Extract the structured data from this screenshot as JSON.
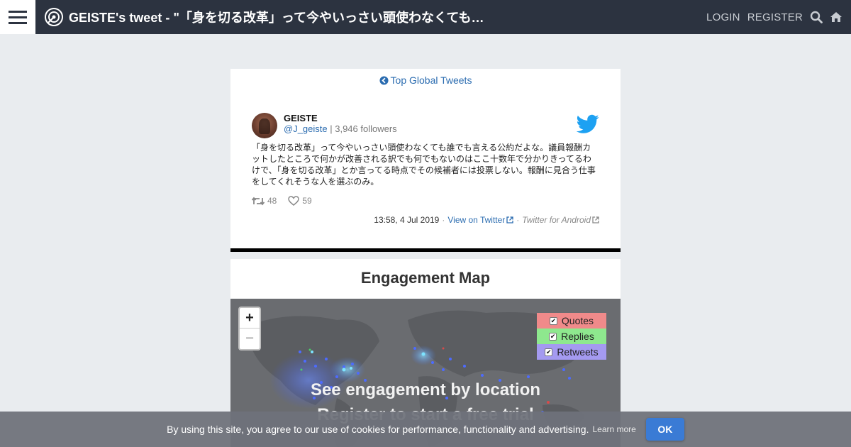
{
  "header": {
    "title": "GEISTE's tweet - \"「身を切る改革」って今やいっさい頭使わなくても…",
    "login_label": "LOGIN",
    "register_label": "REGISTER",
    "icons": [
      "menu-icon",
      "logo-icon",
      "search-icon",
      "home-icon"
    ]
  },
  "tweet": {
    "back_link": "Top Global Tweets",
    "author_name": "GEISTE",
    "handle": "@J_geiste",
    "followers": "| 3,946 followers",
    "text": "「身を切る改革」って今やいっさい頭使わなくても誰でも言える公約だよな。議員報酬カットしたところで何かが改善される訳でも何でもないのはここ十数年で分かりきってるわけで、「身を切る改革」とか言ってる時点でその候補者には投票しない。報酬に見合う仕事をしてくれそうな人を選ぶのみ。",
    "retweets": "48",
    "likes": "59",
    "timestamp": "13:58, 4 Jul 2019",
    "view_link": "View on Twitter",
    "source": "Twitter for Android"
  },
  "engagement": {
    "title": "Engagement Map",
    "zoom_in": "+",
    "zoom_out": "−",
    "legend": [
      {
        "label": "Quotes",
        "color": "#f08a8a",
        "checked": true
      },
      {
        "label": "Replies",
        "color": "#8ee88e",
        "checked": true
      },
      {
        "label": "Retweets",
        "color": "#a49af0",
        "checked": true
      }
    ],
    "overlay_line1": "See engagement by location",
    "overlay_line2": "Register to start a free trial"
  },
  "cookie": {
    "text": "By using this site, you agree to our use of cookies for performance, functionality and advertising.",
    "learn_more": "Learn more",
    "ok_label": "OK"
  },
  "colors": {
    "topbar": "#2c3340",
    "link": "#2b6cb0",
    "twitter_blue": "#1da1f2",
    "ok_button": "#3a7bd5"
  }
}
